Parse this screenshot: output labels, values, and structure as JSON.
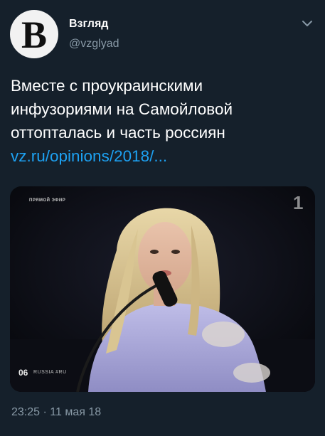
{
  "account": {
    "avatar_letter": "B",
    "display_name": "Взгляд",
    "handle": "@vzglyad"
  },
  "tweet": {
    "text_lines": [
      "Вместе с проукраинскими",
      "инфузориями на Самойловой",
      "оттопталась и часть россиян"
    ],
    "link": "vz.ru/opinions/2018/..."
  },
  "media": {
    "live_label": "ПРЯМОЙ ЭФИР",
    "channel_logo": "1",
    "performance_number": "06",
    "country_label": "RUSSIA #RU"
  },
  "meta": {
    "timestamp": "23:25 · 11 мая 18"
  },
  "icons": {
    "menu": "chevron-down-icon"
  },
  "colors": {
    "background": "#15202b",
    "link": "#1da1f2",
    "secondary_text": "#8899a6"
  }
}
